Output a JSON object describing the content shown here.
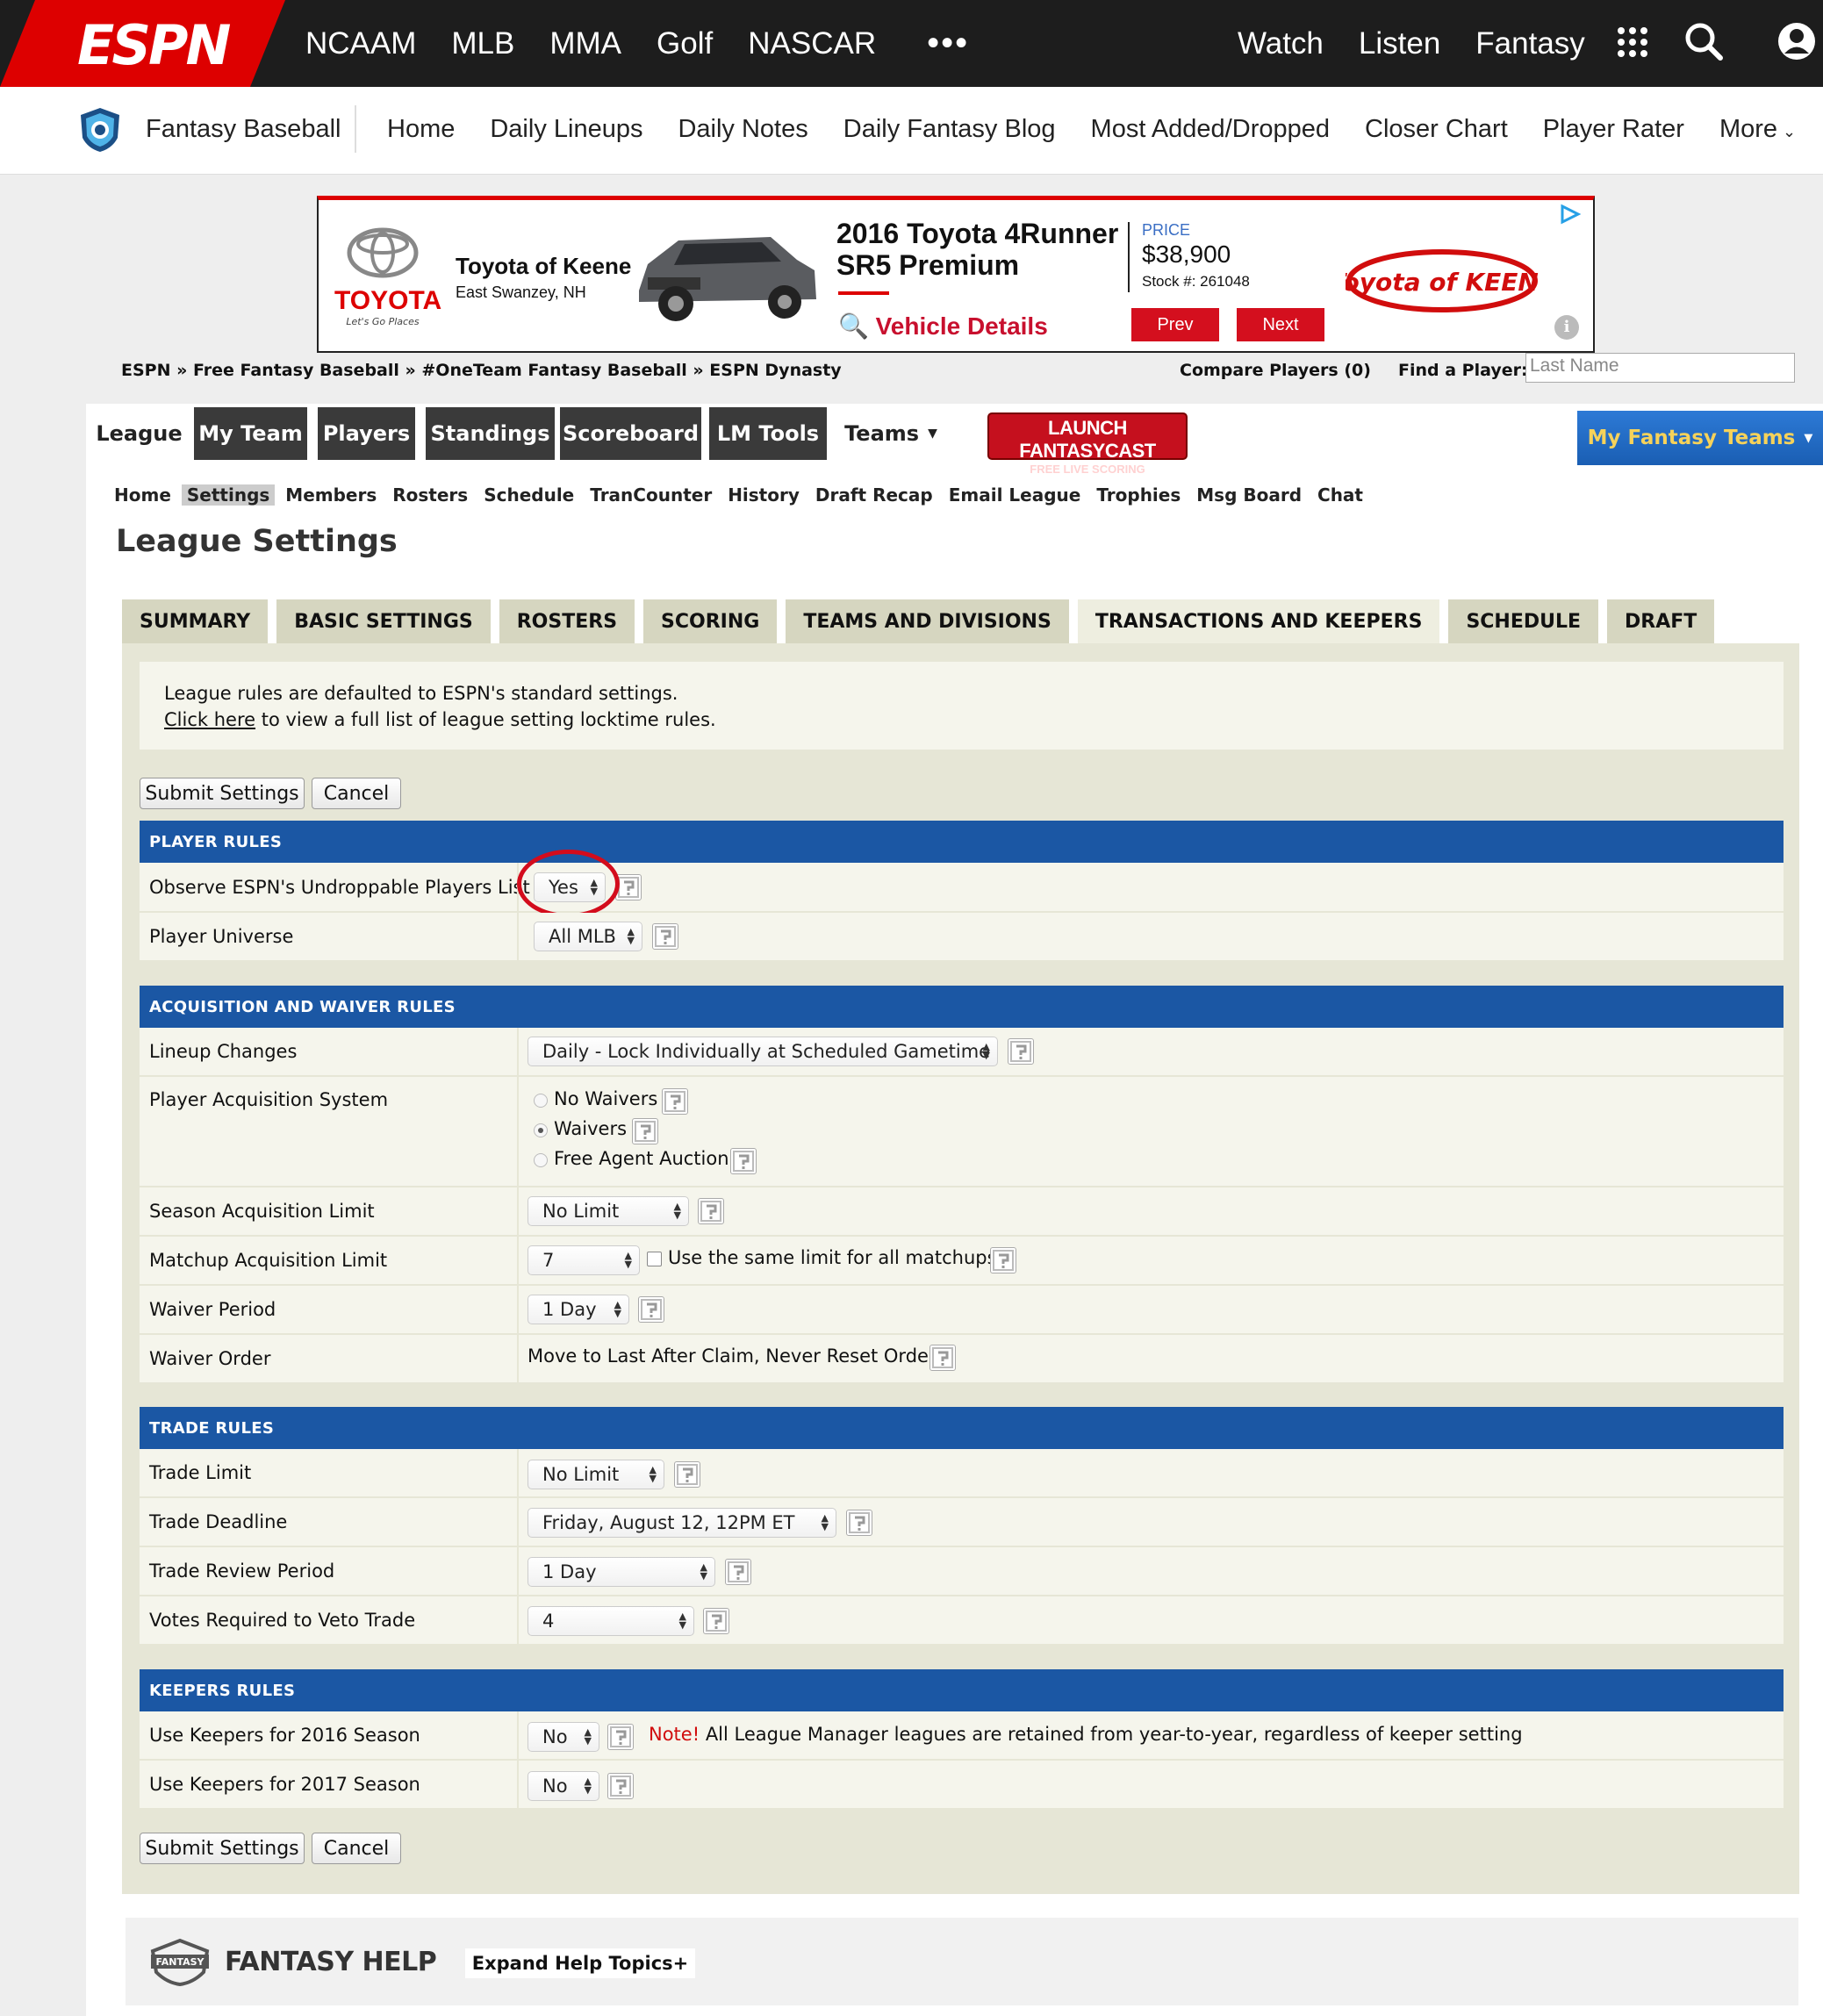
{
  "topnav": {
    "logo": "ESPN",
    "links": [
      "NCAAM",
      "MLB",
      "MMA",
      "Golf",
      "NASCAR"
    ],
    "more": "•••",
    "right_links": [
      "Watch",
      "Listen",
      "Fantasy"
    ],
    "icons": [
      "apps-grid-icon",
      "search-icon",
      "user-icon"
    ]
  },
  "subnav": {
    "title": "Fantasy Baseball",
    "links": [
      "Home",
      "Daily Lineups",
      "Daily Notes",
      "Daily Fantasy Blog",
      "Most Added/Dropped",
      "Closer Chart",
      "Player Rater",
      "More"
    ]
  },
  "ad": {
    "brand": "TOYOTA",
    "slogan": "Let's Go Places",
    "dealer": "Toyota of Keene",
    "location": "East Swanzey, NH",
    "model": "2016 Toyota 4Runner SR5 Premium",
    "details_link": "Vehicle Details",
    "price_label": "PRICE",
    "price": "$38,900",
    "stock": "Stock #: 261048",
    "prev": "Prev",
    "next": "Next",
    "dealer_logo": "Toyota of KEENE"
  },
  "breadcrumb": "ESPN » Free Fantasy Baseball » #OneTeam Fantasy Baseball » ESPN Dynasty",
  "compare": "Compare Players (0)",
  "find_player": {
    "label": "Find a Player:",
    "placeholder": "Last Name"
  },
  "main_tabs": [
    "League",
    "My Team",
    "Players",
    "Standings",
    "Scoreboard",
    "LM Tools",
    "Teams"
  ],
  "fantasycast": {
    "line1": "LAUNCH FANTASYCAST",
    "line2": "FREE LIVE SCORING"
  },
  "my_fantasy_teams": "My Fantasy Teams",
  "sub_tabs": [
    "Home",
    "Settings",
    "Members",
    "Rosters",
    "Schedule",
    "TranCounter",
    "History",
    "Draft Recap",
    "Email League",
    "Trophies",
    "Msg Board",
    "Chat"
  ],
  "page_title": "League Settings",
  "settings_tabs": [
    "SUMMARY",
    "BASIC SETTINGS",
    "ROSTERS",
    "SCORING",
    "TEAMS AND DIVISIONS",
    "TRANSACTIONS AND KEEPERS",
    "SCHEDULE",
    "DRAFT"
  ],
  "active_settings_tab": "TRANSACTIONS AND KEEPERS",
  "notice": {
    "line1": "League rules are defaulted to ESPN's standard settings.",
    "link": "Click here",
    "line2_rest": " to view a full list of league setting locktime rules."
  },
  "buttons": {
    "submit": "Submit Settings",
    "cancel": "Cancel"
  },
  "sections": {
    "player_rules": {
      "title": "PLAYER RULES",
      "rows": [
        {
          "label": "Observe ESPN's Undroppable Players List",
          "value": "Yes"
        },
        {
          "label": "Player Universe",
          "value": "All MLB"
        }
      ]
    },
    "acquisition": {
      "title": "ACQUISITION AND WAIVER RULES",
      "lineup_label": "Lineup Changes",
      "lineup_value": "Daily - Lock Individually at Scheduled Gametime",
      "system_label": "Player Acquisition System",
      "system_options": [
        "No Waivers",
        "Waivers",
        "Free Agent Auction"
      ],
      "system_selected": "Waivers",
      "season_limit_label": "Season Acquisition Limit",
      "season_limit_value": "No Limit",
      "matchup_limit_label": "Matchup Acquisition Limit",
      "matchup_limit_value": "7",
      "matchup_same_label": "Use the same limit for all matchups",
      "matchup_same_checked": false,
      "waiver_period_label": "Waiver Period",
      "waiver_period_value": "1 Day",
      "waiver_order_label": "Waiver Order",
      "waiver_order_value": "Move to Last After Claim, Never Reset Order"
    },
    "trade": {
      "title": "TRADE RULES",
      "rows": [
        {
          "label": "Trade Limit",
          "value": "No Limit"
        },
        {
          "label": "Trade Deadline",
          "value": "Friday, August 12, 12PM ET"
        },
        {
          "label": "Trade Review Period",
          "value": "1 Day"
        },
        {
          "label": "Votes Required to Veto Trade",
          "value": "4"
        }
      ]
    },
    "keepers": {
      "title": "KEEPERS RULES",
      "rows": [
        {
          "label": "Use Keepers for 2016 Season",
          "value": "No"
        },
        {
          "label": "Use Keepers for 2017 Season",
          "value": "No"
        }
      ],
      "note_label": "Note!",
      "note_text": " All League Manager leagues are retained from year-to-year, regardless of keeper setting"
    }
  },
  "help_footer": {
    "logo_text": "FANTASY",
    "title": "FANTASY HELP",
    "expand": "Expand Help Topics+"
  },
  "colors": {
    "espn_red": "#dd0000",
    "section_blue": "#1b57a4",
    "panel_beige": "#e6e6d6",
    "highlight_circle": "#d30c1c"
  }
}
